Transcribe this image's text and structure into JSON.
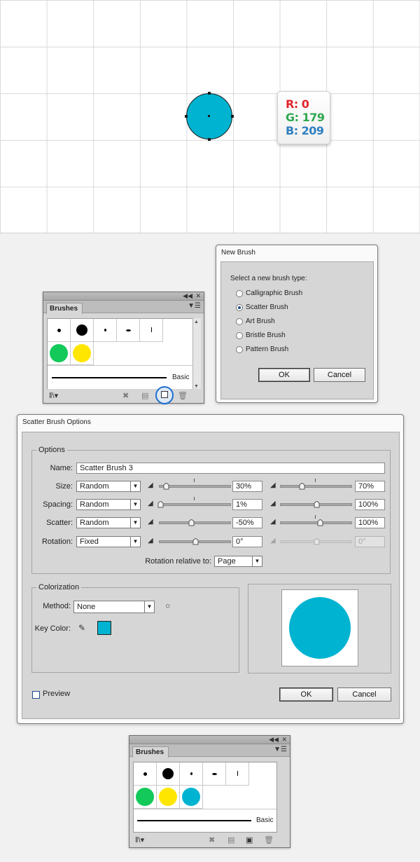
{
  "artboard": {
    "rgb_tag": {
      "r": "R: 0",
      "g": "G: 179",
      "b": "B: 209",
      "r_color": "#e2262f",
      "g_color": "#2fa851",
      "b_color": "#2f7fbf"
    },
    "circle_fill": "#00b3d1"
  },
  "brushes_panel": {
    "tab": "Brushes",
    "collapse_icon": "double-chevron-icon",
    "close_icon": "close-icon",
    "menu_icon": "panel-menu-icon",
    "basic_label": "Basic",
    "swatch_green": "#12c95a",
    "swatch_yellow": "#ffe600",
    "swatch_blue": "#00b3d1"
  },
  "new_brush": {
    "title": "New Brush",
    "prompt": "Select a new brush type:",
    "options": [
      "Calligraphic Brush",
      "Scatter Brush",
      "Art Brush",
      "Bristle Brush",
      "Pattern Brush"
    ],
    "selected": "Scatter Brush",
    "ok": "OK",
    "cancel": "Cancel"
  },
  "scatter_options": {
    "title": "Scatter Brush Options",
    "options_group": "Options",
    "name_label": "Name:",
    "name_value": "Scatter Brush 3",
    "size": {
      "label": "Size:",
      "mode": "Random",
      "min": "30%",
      "max": "70%",
      "min_frac": 0.1,
      "max_frac": 0.3
    },
    "spacing": {
      "label": "Spacing:",
      "mode": "Random",
      "min": "1%",
      "max": "100%",
      "min_frac": 0.02,
      "max_frac": 0.5
    },
    "scatter": {
      "label": "Scatter:",
      "mode": "Random",
      "min": "-50%",
      "max": "100%",
      "min_frac": 0.45,
      "max_frac": 0.55
    },
    "rotation": {
      "label": "Rotation:",
      "mode": "Fixed",
      "min": "0°",
      "max": "0°",
      "min_frac": 0.5,
      "max_frac": 0.5
    },
    "rotation_relative_label": "Rotation relative to:",
    "rotation_relative_value": "Page",
    "colorization_group": "Colorization",
    "method_label": "Method:",
    "method_value": "None",
    "key_color_label": "Key Color:",
    "key_color": "#00b3d1",
    "preview_label": "Preview",
    "ok": "OK",
    "cancel": "Cancel"
  }
}
